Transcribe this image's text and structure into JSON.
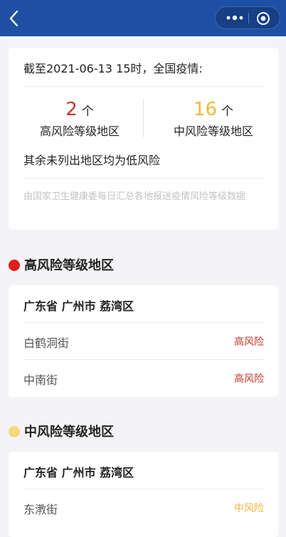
{
  "colors": {
    "nav_bg": "#1d4fa3",
    "high_risk": "#c0392b",
    "medium_risk": "#f0b73a",
    "high_dot": "#e0201a",
    "medium_dot": "#f6d97a"
  },
  "nav": {
    "back_icon": "chevron-left-icon",
    "more_icon": "more-dots-icon",
    "close_icon": "target-close-icon"
  },
  "summary": {
    "headline": "截至2021-06-13 15时，全国疫情:",
    "high": {
      "count": "2",
      "unit": "个",
      "label": "高风险等级地区"
    },
    "medium": {
      "count": "16",
      "unit": "个",
      "label": "中风险等级地区"
    },
    "note": "其余未列出地区均为低风险",
    "source": "由国家卫生健康委每日汇总各地报送疫情风险等级数据"
  },
  "high_section": {
    "title": "高风险等级地区",
    "region": "广东省 广州市 荔湾区",
    "rows": [
      {
        "name": "白鹤洞街",
        "risk": "高风险"
      },
      {
        "name": "中南街",
        "risk": "高风险"
      }
    ]
  },
  "medium_section": {
    "title": "中风险等级地区",
    "region": "广东省 广州市 荔湾区",
    "rows": [
      {
        "name": "东漖街",
        "risk": "中风险"
      }
    ]
  }
}
